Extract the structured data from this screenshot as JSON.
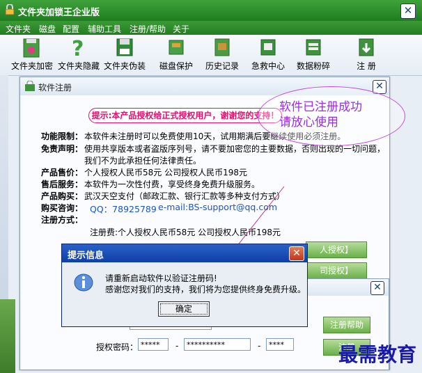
{
  "main": {
    "title": "文件夹加锁王企业版",
    "close": "✕",
    "menu": [
      "文件夹",
      "磁盘",
      "配置",
      "辅助工具",
      "注册/帮助",
      "关于"
    ],
    "tools": [
      "文件夹加密",
      "文件夹隐藏",
      "文件夹伪装",
      "磁盘保护",
      "历史记录",
      "急救中心",
      "数据粉碎",
      "注 册"
    ]
  },
  "register": {
    "title": "软件注册",
    "close": "✕",
    "banner": "提示:本产品授权给正式授权用户，谢谢您的支持！",
    "rows": [
      {
        "label": "功能限制：",
        "text": "本软件未注册时可以免费使用10天，试用期满后要继续使用必须注册。"
      },
      {
        "label": "免责声明：",
        "text": "使用共享版本或者盗版序列号，请不要加密您的主要数据，否则出现的一切问题，"
      },
      {
        "label": "",
        "text": "我们不为此承担任何法律责任。"
      },
      {
        "label": "产品售价：",
        "text": "个人授权人民币58元  公司授权人民币198元"
      },
      {
        "label": "售后服务：",
        "text": "本软件为一次性付费，享受终身免费升级服务。"
      },
      {
        "label": "产品购买：",
        "text": "武汉天空支付（邮政汇款、银行汇款等多种支付方式）"
      }
    ],
    "contact_label": "购买咨询：",
    "qq": "QQ：78925789",
    "email": "e-mail:BS-support@qq.com",
    "method_label": "注册方式：",
    "fee": "注册费:个人授权人民币58元  公司授权人民币198元",
    "btn_personal": "人授权】",
    "btn_company": "司授权】",
    "annotation": [
      "软件已注册成功",
      "请放心使用"
    ]
  },
  "sub": {
    "close": "✕",
    "help_btn": "注册帮助",
    "reg_btn": "注册",
    "code_label": "授权密码：",
    "code1": "*****",
    "code2": "**********",
    "code3": "****",
    "dash": "-"
  },
  "msgbox": {
    "title": "提示信息",
    "close": "✕",
    "line1": "请重新启动软件以验证注册码!",
    "line2": "感谢您对我们的支持，我们将为您提供终身免费升级。",
    "ok": "确定"
  },
  "watermark": "最需教育"
}
